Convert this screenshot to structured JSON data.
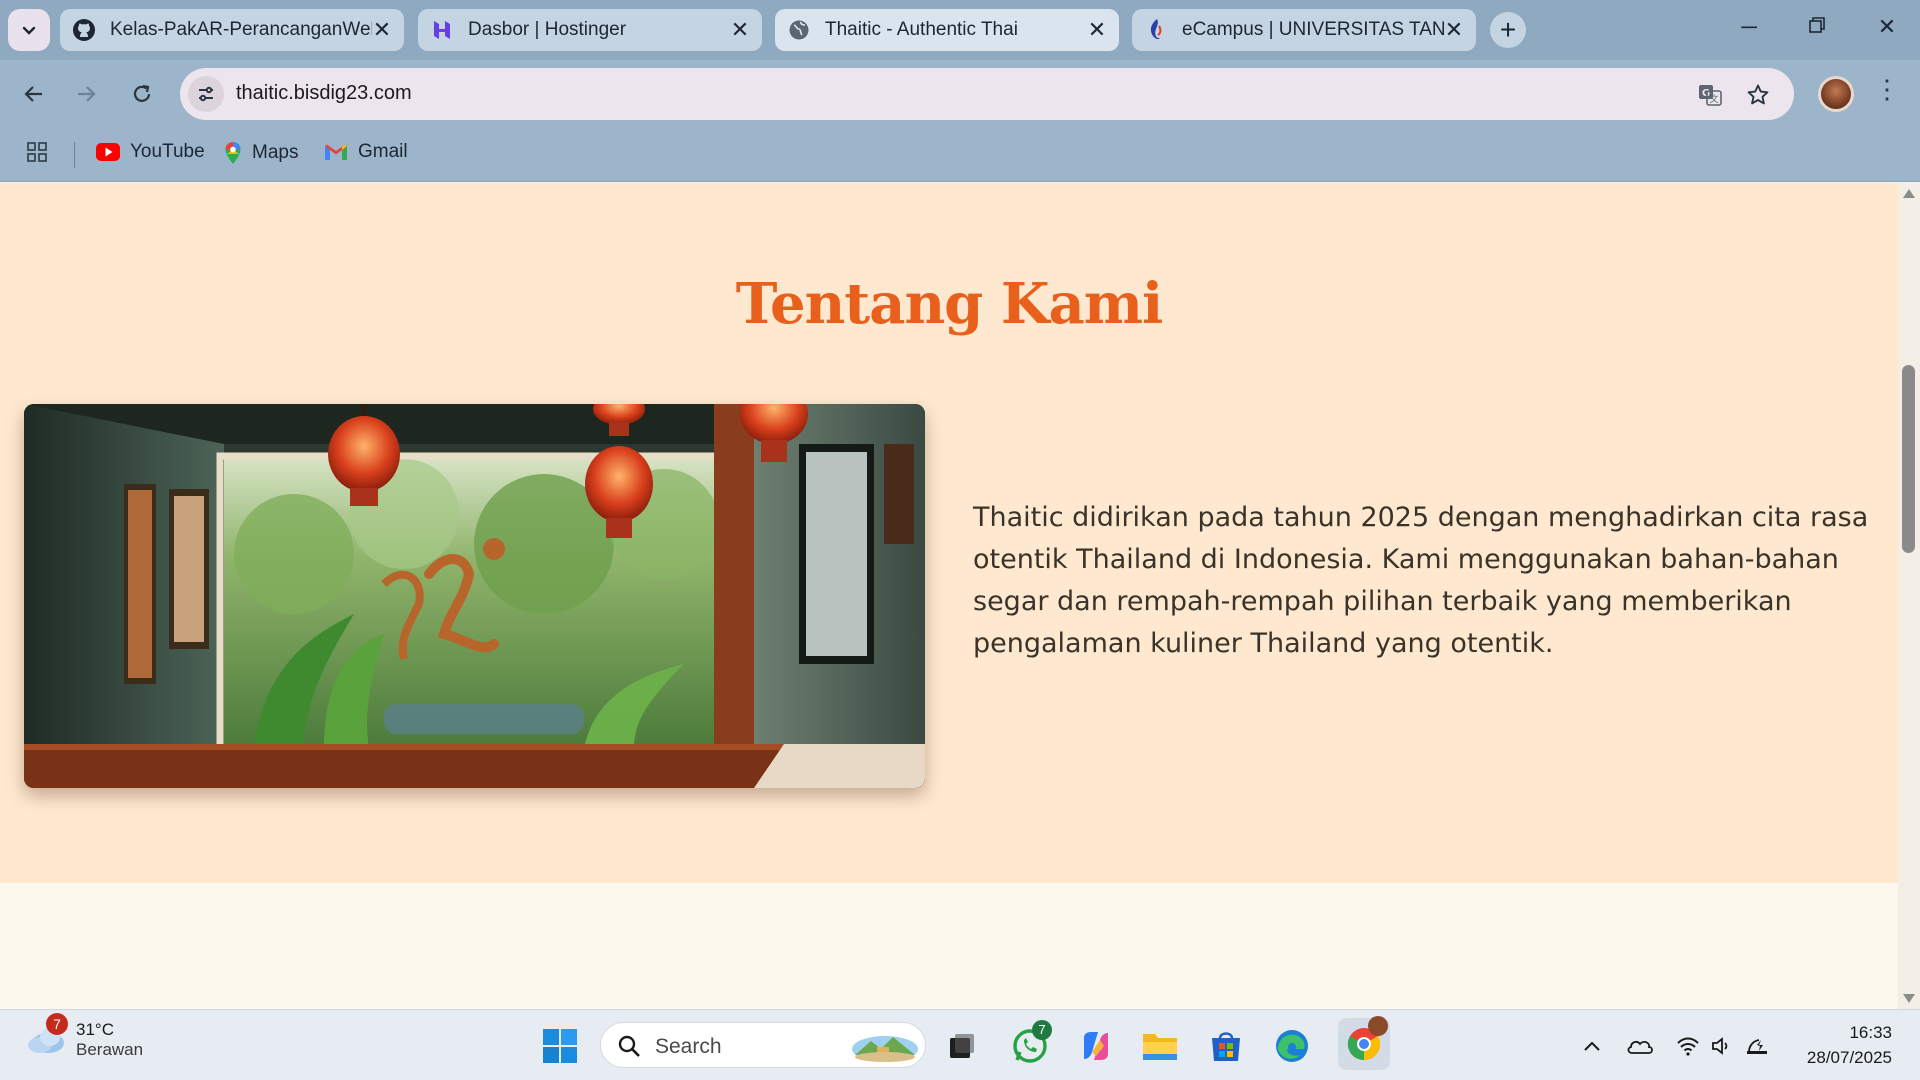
{
  "browser": {
    "tabs": [
      {
        "title": "Kelas-PakAR-PerancanganWebI",
        "icon": "github-icon",
        "active": false
      },
      {
        "title": "Dasbor | Hostinger",
        "icon": "hostinger-icon",
        "active": false
      },
      {
        "title": "Thaitic - Authentic Thai",
        "icon": "globe-icon",
        "active": true
      },
      {
        "title": "eCampus | UNIVERSITAS TANGE",
        "icon": "ecampus-icon",
        "active": false
      }
    ],
    "url": "thaitic.bisdig23.com",
    "bookmarks": [
      {
        "label": "YouTube",
        "icon": "youtube-icon"
      },
      {
        "label": "Maps",
        "icon": "maps-icon"
      },
      {
        "label": "Gmail",
        "icon": "gmail-icon"
      }
    ]
  },
  "page": {
    "about": {
      "title": "Tentang Kami",
      "description": "Thaitic didirikan pada tahun 2025 dengan menghadirkan cita rasa otentik Thailand di Indonesia. Kami menggunakan bahan-bahan segar dan rempah-rempah pilihan terbaik yang memberikan pengalaman kuliner Thailand yang otentik."
    },
    "colors": {
      "accent": "#e8601c",
      "section_bg": "#fee9d0",
      "page_bg": "#fdf8ee"
    }
  },
  "taskbar": {
    "weather": {
      "temp": "31°C",
      "condition": "Berawan",
      "badge": "7"
    },
    "search_placeholder": "Search",
    "whatsapp_badge": "7",
    "time": "16:33",
    "date": "28/07/2025"
  }
}
